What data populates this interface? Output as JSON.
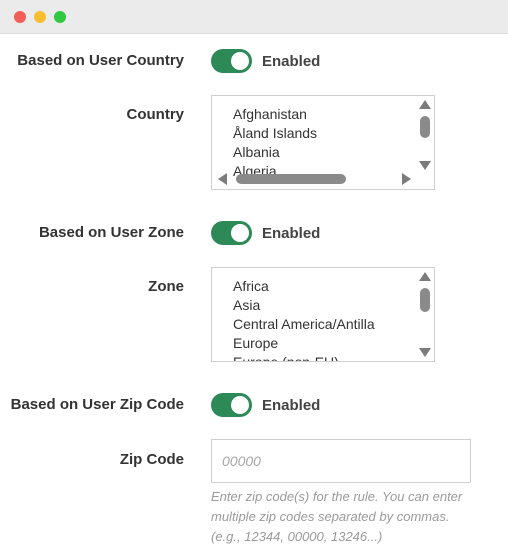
{
  "window": {
    "traffic_lights": {
      "close": "#f25e57",
      "minimize": "#f6bd2f",
      "zoom": "#2fc840"
    }
  },
  "accent": "#2d8a57",
  "country_section": {
    "toggle_label": "Based on User Country",
    "toggle_state": "Enabled",
    "list_label": "Country",
    "options": [
      "Afghanistan",
      "Åland Islands",
      "Albania",
      "Algeria"
    ]
  },
  "zone_section": {
    "toggle_label": "Based on User Zone",
    "toggle_state": "Enabled",
    "list_label": "Zone",
    "options": [
      "Africa",
      "Asia",
      "Central America/Antilla",
      "Europe",
      "Europe (non-EU)"
    ]
  },
  "zip_section": {
    "toggle_label": "Based on User Zip Code",
    "toggle_state": "Enabled",
    "field_label": "Zip Code",
    "placeholder": "00000",
    "help_text": "Enter zip code(s) for the rule. You can enter multiple zip codes separated by commas. (e.g., 12344, 00000, 13246...)"
  }
}
